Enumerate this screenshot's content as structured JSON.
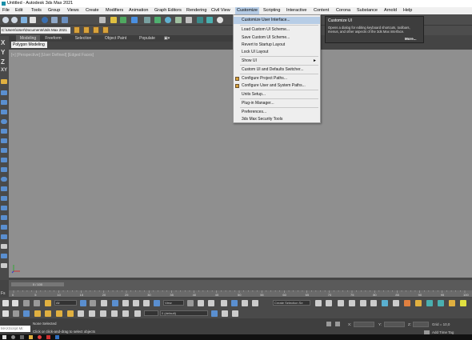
{
  "window": {
    "title": "Untitled - Autodesk 3ds Max 2021"
  },
  "menubar": {
    "items": [
      "File",
      "Edit",
      "Tools",
      "Group",
      "Views",
      "Create",
      "Modifiers",
      "Animation",
      "Graph Editors",
      "Rendering",
      "Civil View",
      "Customize",
      "Scripting",
      "Interactive",
      "Content",
      "Corona",
      "Substance",
      "Arnold",
      "Help"
    ],
    "active": "Customize"
  },
  "toolbar": {
    "label_3dclub": "3DCLUB"
  },
  "project": {
    "path": "C:\\Users\\User\\Documents\\3ds Max 2021"
  },
  "ribbon": {
    "tabs": [
      "Modeling",
      "Freeform",
      "Selection",
      "Object Paint",
      "Populate"
    ],
    "active_tab": "Modeling",
    "panel_label": "Polygon Modeling"
  },
  "left_toolbar": {
    "axes": [
      "X",
      "Y",
      "Z",
      "XY"
    ]
  },
  "viewport": {
    "label": "[+] [Perspective] [User Defined] [Edged Faces]"
  },
  "timeline": {
    "slider_label": "0 / 100",
    "ticks": [
      "0",
      "5",
      "10",
      "15",
      "20",
      "25",
      "30",
      "35",
      "40",
      "45",
      "50",
      "55",
      "60",
      "65",
      "70",
      "75",
      "80",
      "85",
      "90",
      "95",
      "100"
    ],
    "fps_label": "Fs"
  },
  "bottom_toolbar": {
    "view_dropdown": "All",
    "view2_dropdown": "View",
    "selection_set": "Create Selection Se",
    "layer_dropdown": "0 (default)"
  },
  "status_bar": {
    "maxscript": "MAXScript Mi:",
    "line1": "None Selected",
    "line2": "Click or click-and-drag to select objects",
    "x_label": "X:",
    "y_label": "Y:",
    "z_label": "Z:",
    "grid": "Grid = 10,0",
    "add_time_tag": "Add Time Tag"
  },
  "customize_menu": {
    "items": [
      "Customize User Interface...",
      "Load Custom UI Scheme...",
      "Save Custom UI Scheme...",
      "Revert to Startup Layout",
      "Lock UI Layout",
      "Show UI",
      "Custom UI and Defaults Switcher...",
      "Configure Project Paths...",
      "Configure User and System Paths...",
      "Units Setup...",
      "Plug-in Manager...",
      "Preferences...",
      "3ds Max Security Tools"
    ],
    "highlighted": "Customize User Interface..."
  },
  "tooltip": {
    "title": "Customize UI",
    "body": "Opens a dialog for editing keyboard shortcuts, toolbars, menus, and other aspects of the 3ds Max interface.",
    "more": "More..."
  },
  "colors": {
    "highlight": "#b7cde6",
    "viewport_bg": "#8f8f8f",
    "ui_dark": "#4a4a4a"
  }
}
